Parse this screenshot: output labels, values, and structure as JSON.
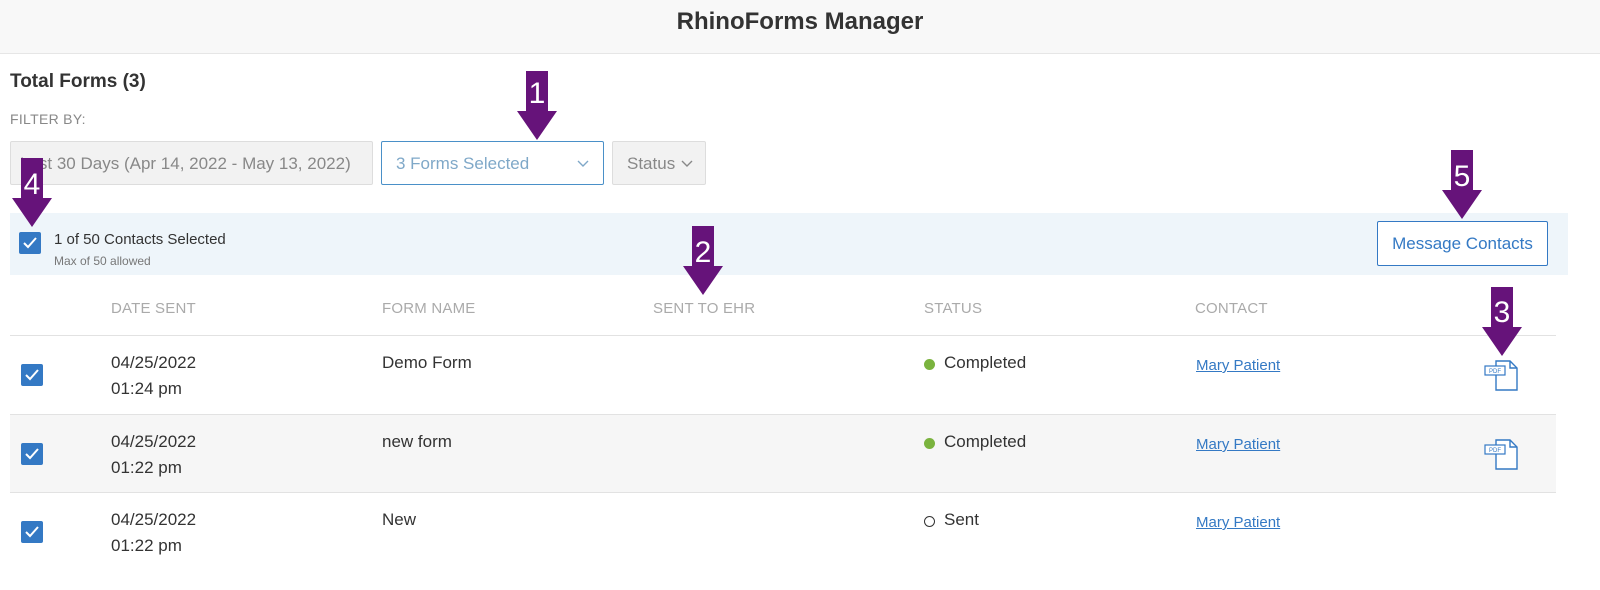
{
  "header": {
    "title": "RhinoForms Manager"
  },
  "summary": {
    "total_forms": "Total Forms (3)",
    "filter_label": "FILTER BY:"
  },
  "filters": {
    "date_range": "Last 30 Days (Apr 14, 2022 - May 13, 2022)",
    "forms": "3 Forms Selected",
    "status": "Status"
  },
  "selection": {
    "count_text": "1 of 50 Contacts Selected",
    "max_text": "Max of 50 allowed",
    "checked": true
  },
  "actions": {
    "message_contacts": "Message Contacts"
  },
  "table": {
    "headers": [
      "DATE SENT",
      "FORM NAME",
      "SENT TO EHR",
      "STATUS",
      "CONTACT"
    ],
    "rows": [
      {
        "date": "04/25/2022",
        "time": "01:24 pm",
        "form_name": "Demo Form",
        "sent_to_ehr": "",
        "status": "Completed",
        "contact": "Mary Patient",
        "has_pdf": true,
        "checked": true
      },
      {
        "date": "04/25/2022",
        "time": "01:22 pm",
        "form_name": "new form",
        "sent_to_ehr": "",
        "status": "Completed",
        "contact": "Mary Patient",
        "has_pdf": true,
        "checked": true
      },
      {
        "date": "04/25/2022",
        "time": "01:22 pm",
        "form_name": "New",
        "sent_to_ehr": "",
        "status": "Sent",
        "contact": "Mary Patient",
        "has_pdf": false,
        "checked": true
      }
    ]
  },
  "annotations": [
    "1",
    "2",
    "3",
    "4",
    "5"
  ],
  "colors": {
    "accent": "#3479c4",
    "status_completed": "#7ab33e",
    "annotation_arrow": "#66137a",
    "selection_bar": "#eef5fa"
  },
  "icons": {
    "forms_dropdown": "chevron-down-icon",
    "status_dropdown": "chevron-down-icon",
    "row_checkbox": "checkmark-icon",
    "pdf": "pdf-icon"
  }
}
